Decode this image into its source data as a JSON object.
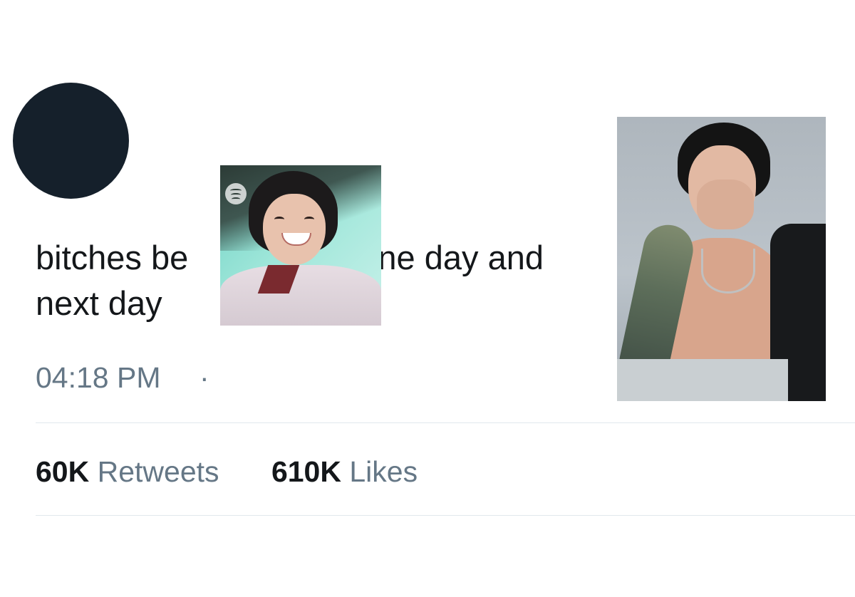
{
  "tweet": {
    "avatar_color": "#15202b",
    "text_line1_before": "bitches be",
    "text_line1_after": "one day and",
    "text_line2": "next day",
    "inline_image_1": "selfie-photo",
    "inline_image_2": "portrait-photo",
    "spotify_icon": "spotify-icon",
    "timestamp": "04:18 PM",
    "separator": "·"
  },
  "stats": {
    "retweets_count": "60K",
    "retweets_label": "Retweets",
    "likes_count": "610K",
    "likes_label": "Likes"
  },
  "colors": {
    "text_primary": "#14171a",
    "text_secondary": "#657786",
    "divider": "#e1e8ed"
  }
}
